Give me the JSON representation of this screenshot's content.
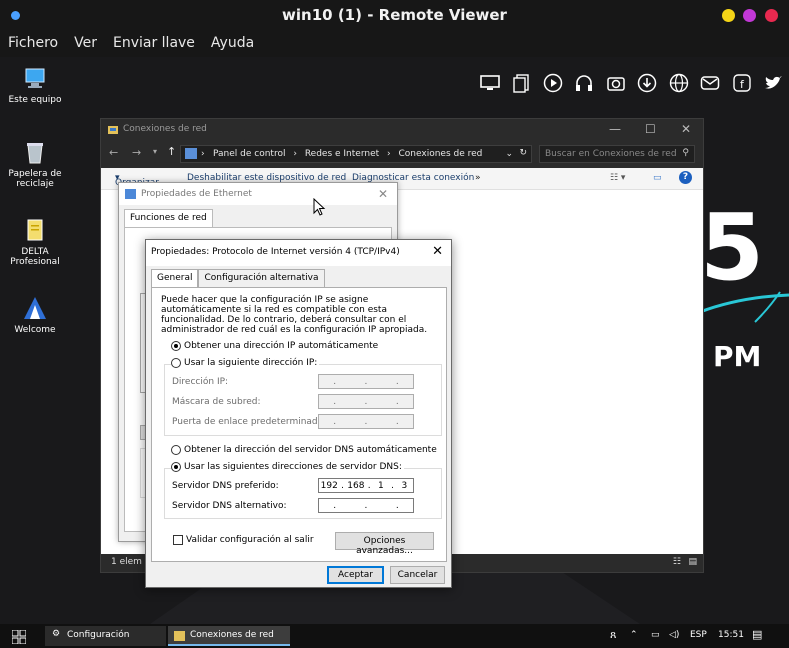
{
  "viewer": {
    "title": "win10 (1) - Remote Viewer",
    "menu": [
      "Fichero",
      "Ver",
      "Enviar llave",
      "Ayuda"
    ]
  },
  "desktop": {
    "icons": [
      "Este equipo",
      "Papelera de reciclaje",
      "DELTA Profesional",
      "Welcome"
    ],
    "wallpaper_text": {
      "digit": "5",
      "suffix": "PM"
    }
  },
  "explorer": {
    "title": "Conexiones de red",
    "breadcrumb": [
      "Panel de control",
      "Redes e Internet",
      "Conexiones de red"
    ],
    "search_placeholder": "Buscar en Conexiones de red",
    "toolbar": [
      "Organizar",
      "Deshabilitar este dispositivo de red",
      "Diagnosticar esta conexión"
    ],
    "status": "1 elem"
  },
  "ethernet": {
    "title": "Propiedades de Ethernet",
    "tab": "Funciones de red"
  },
  "ipv4": {
    "title": "Propiedades: Protocolo de Internet versión 4 (TCP/IPv4)",
    "tabs": [
      "General",
      "Configuración alternativa"
    ],
    "description": "Puede hacer que la configuración IP se asigne automáticamente si la red es compatible con esta funcionalidad. De lo contrario, deberá consultar con el administrador de red cuál es la configuración IP apropiada.",
    "ip_auto": "Obtener una dirección IP automáticamente",
    "ip_manual": "Usar la siguiente dirección IP:",
    "ip_address_label": "Dirección IP:",
    "subnet_label": "Máscara de subred:",
    "gateway_label": "Puerta de enlace predeterminada:",
    "dns_auto": "Obtener la dirección del servidor DNS automáticamente",
    "dns_manual": "Usar las siguientes direcciones de servidor DNS:",
    "dns_preferred_label": "Servidor DNS preferido:",
    "dns_preferred": [
      "192",
      "168",
      "1",
      "3"
    ],
    "dns_alternate_label": "Servidor DNS alternativo:",
    "validate": "Validar configuración al salir",
    "advanced": "Opciones avanzadas...",
    "ok": "Aceptar",
    "cancel": "Cancelar"
  },
  "taskbar": {
    "items": [
      "Configuración",
      "Conexiones de red"
    ],
    "lang": "ESP",
    "time": "15:51"
  }
}
